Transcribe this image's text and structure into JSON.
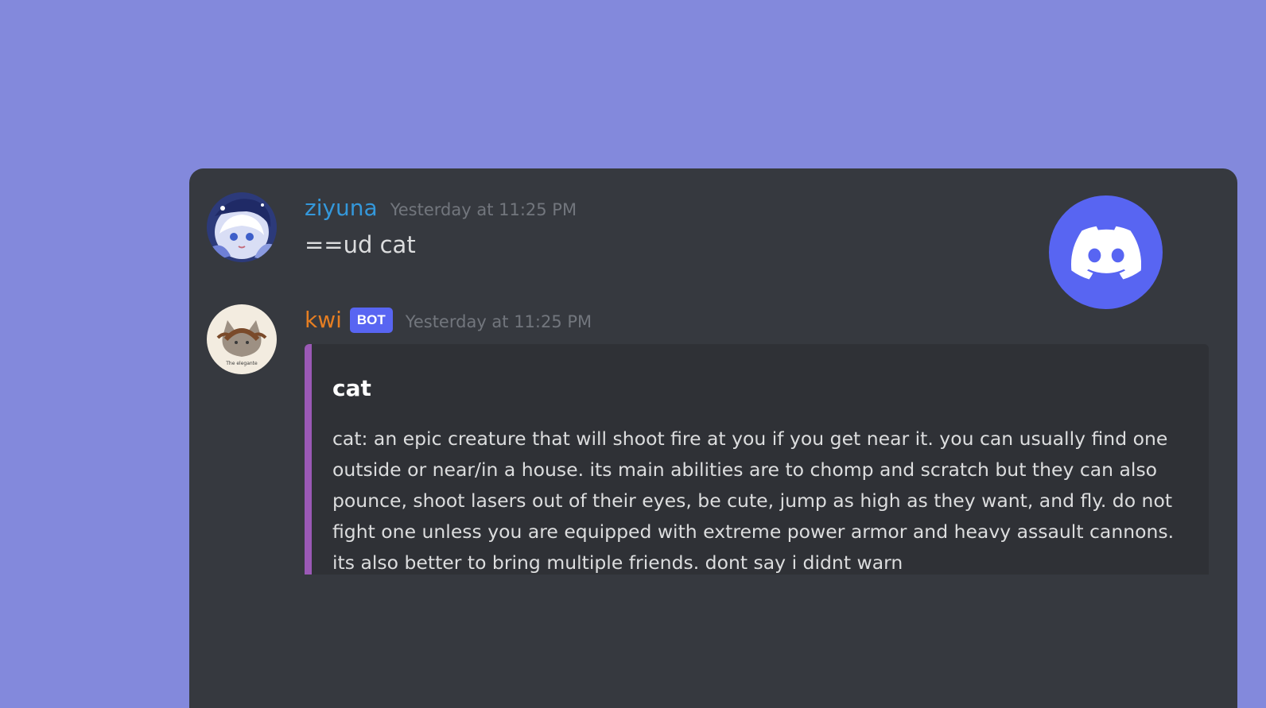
{
  "messages": [
    {
      "username": "ziyuna",
      "timestamp": "Yesterday at 11:25 PM",
      "content": "==ud cat",
      "username_color": "#3498db"
    },
    {
      "username": "kwi",
      "badge": "BOT",
      "timestamp": "Yesterday at 11:25 PM",
      "username_color": "#e67e22",
      "embed": {
        "title": "cat",
        "description": "cat: an epic creature that will shoot fire at you if you get near it. you can usually find one outside or near/in a house. its main abilities are to chomp and scratch but they can also pounce, shoot lasers out of their eyes, be cute, jump as high as they want, and fly. do not fight one unless you are equipped with extreme power armor and heavy assault cannons. its also better to bring multiple friends. dont say i didnt warn",
        "accent_color": "#9b59b6"
      }
    }
  ],
  "avatar_caption": "The elegante",
  "colors": {
    "background": "#8389dc",
    "chat_background": "#36393f",
    "embed_background": "#2f3136",
    "discord_blurple": "#5865f2"
  },
  "icons": {
    "logo": "discord-logo-icon"
  }
}
